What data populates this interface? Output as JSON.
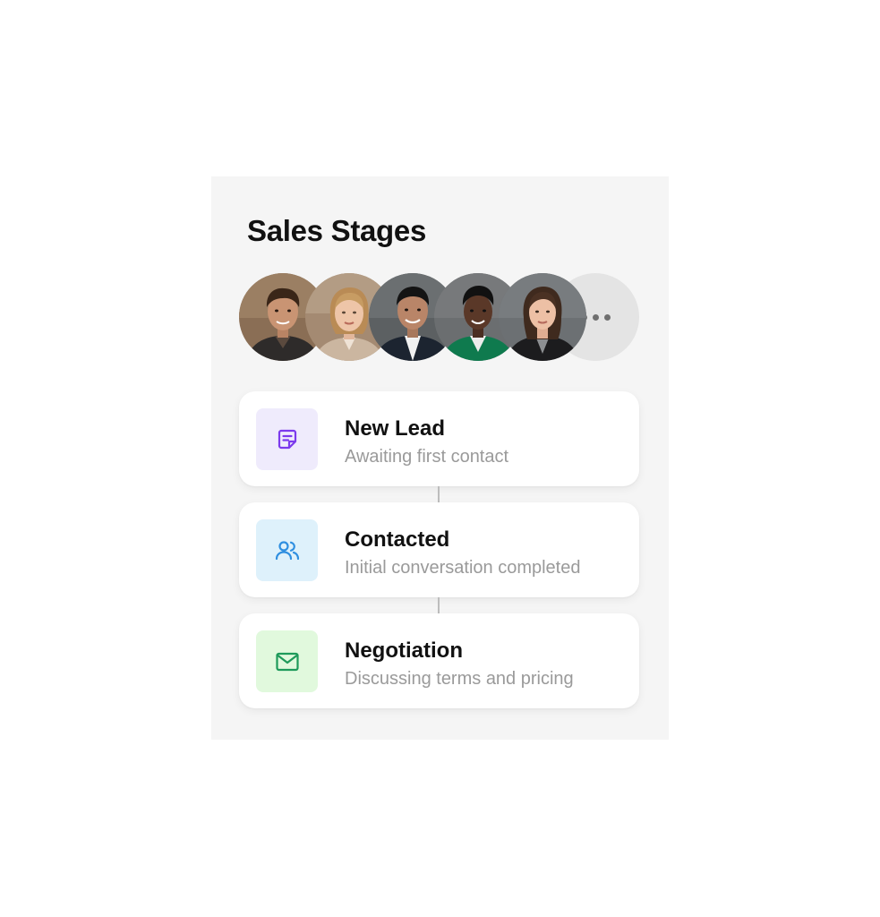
{
  "panel": {
    "title": "Sales Stages"
  },
  "team": {
    "members": [
      {
        "avatar": "man-curly-hair-avatar"
      },
      {
        "avatar": "woman-blonde-hair-avatar"
      },
      {
        "avatar": "man-dark-hair-suit-avatar"
      },
      {
        "avatar": "woman-short-hair-green-blazer-avatar"
      },
      {
        "avatar": "woman-long-hair-dark-blazer-avatar"
      }
    ],
    "more_icon": "ellipsis-icon"
  },
  "stages": [
    {
      "name": "New Lead",
      "description": "Awaiting first contact",
      "icon": "sticky-note-icon",
      "icon_color": "#7c3aed",
      "icon_bg": "#efebfc"
    },
    {
      "name": "Contacted",
      "description": "Initial conversation completed",
      "icon": "users-icon",
      "icon_color": "#2f8fe0",
      "icon_bg": "#def1fb"
    },
    {
      "name": "Negotiation",
      "description": "Discussing terms and pricing",
      "icon": "mail-icon",
      "icon_color": "#1e9a5a",
      "icon_bg": "#e1f9dd"
    }
  ]
}
